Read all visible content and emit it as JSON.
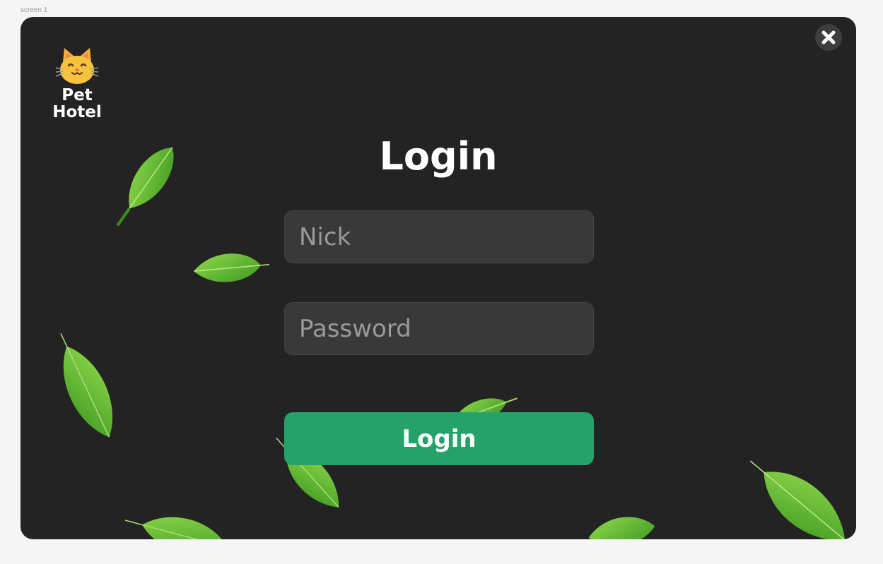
{
  "screen_label": "screen 1",
  "logo": {
    "icon": "cat-face-icon",
    "line1": "Pet",
    "line2": "Hotel"
  },
  "title": "Login",
  "form": {
    "nick_placeholder": "Nick",
    "password_placeholder": "Password",
    "login_label": "Login"
  },
  "close_icon": "close-icon",
  "colors": {
    "page_background": "#f5f5f5",
    "frame_background": "#232323",
    "input_background": "#393939",
    "accent": "#25a26a",
    "leaf_green": "#5fb832"
  }
}
